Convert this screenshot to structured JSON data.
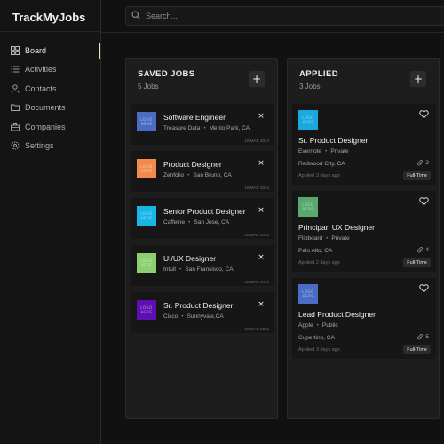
{
  "app": {
    "title": "TrackMyJobs"
  },
  "search": {
    "placeholder": "Search..."
  },
  "sidebar": {
    "items": [
      {
        "label": "Board",
        "icon": "board-icon",
        "active": true
      },
      {
        "label": "Activities",
        "icon": "list-icon",
        "active": false
      },
      {
        "label": "Contacts",
        "icon": "user-icon",
        "active": false
      },
      {
        "label": "Documents",
        "icon": "folder-icon",
        "active": false
      },
      {
        "label": "Companies",
        "icon": "briefcase-icon",
        "active": false
      },
      {
        "label": "Settings",
        "icon": "gear-icon",
        "active": false
      }
    ]
  },
  "columns": {
    "saved": {
      "title": "SAVED JOBS",
      "count": "5 Jobs",
      "add_label": "+",
      "jobs": [
        {
          "title": "Software Engineer",
          "company": "Treasure Data",
          "location": "Menlo Park, CA",
          "date": "18 MAR 2024",
          "logo_text": "LOGO HERE",
          "logo_color": "#4a6cc4",
          "close": "×"
        },
        {
          "title": "Product Designer",
          "company": "Zenfolio",
          "location": "San Bruno, CA",
          "date": "18 MAR 2024",
          "logo_text": "LOGO HERE",
          "logo_color": "#f28a4c",
          "close": "×"
        },
        {
          "title": "Senior Product Designer",
          "company": "Caffeine",
          "location": "San Jose, CA",
          "date": "18 MAR 2024",
          "logo_text": "LOGO HERE",
          "logo_color": "#17b6e6",
          "close": "×"
        },
        {
          "title": "UI/UX Designer",
          "company": "Intuit",
          "location": "San Fransisco, CA",
          "date": "18 MAR 2024",
          "logo_text": "LOGO HERE",
          "logo_color": "#8ccf6e",
          "close": "×"
        },
        {
          "title": "Sr. Product Designer",
          "company": "Cisco",
          "location": "Sunnyvale,CA",
          "date": "18 MAR 2024",
          "logo_text": "LOGO HERE",
          "logo_color": "#5e0fb3",
          "close": "×"
        }
      ]
    },
    "applied": {
      "title": "APPLIED",
      "count": "3 Jobs",
      "add_label": "+",
      "jobs": [
        {
          "title": "Sr. Product Designer",
          "company": "Evernote",
          "visibility": "Private",
          "location": "Redwood City, CA",
          "applied": "Applied 3 days ago",
          "attachments": "2",
          "type": "Full-Time",
          "logo_text": "LOGO HERE",
          "logo_color": "#19a9df"
        },
        {
          "title": "Principan UX Designer",
          "company": "Flipboard",
          "visibility": "Private",
          "location": "Palo Alto, CA",
          "applied": "Applied 2 days ago",
          "attachments": "4",
          "type": "Full-Time",
          "logo_text": "LOGO HERE",
          "logo_color": "#5aa86e"
        },
        {
          "title": "Lead Product Designer",
          "company": "Apple",
          "visibility": "Public",
          "location": "Cupertino, CA",
          "applied": "Applied 3 days ago",
          "attachments": "5",
          "type": "Full-Time",
          "logo_text": "LOGO HERE",
          "logo_color": "#4a6cc4"
        }
      ]
    }
  },
  "colors": {
    "accent": "#e6e6b8",
    "background": "#111111",
    "card": "#161616",
    "column": "#1d1d1d"
  }
}
